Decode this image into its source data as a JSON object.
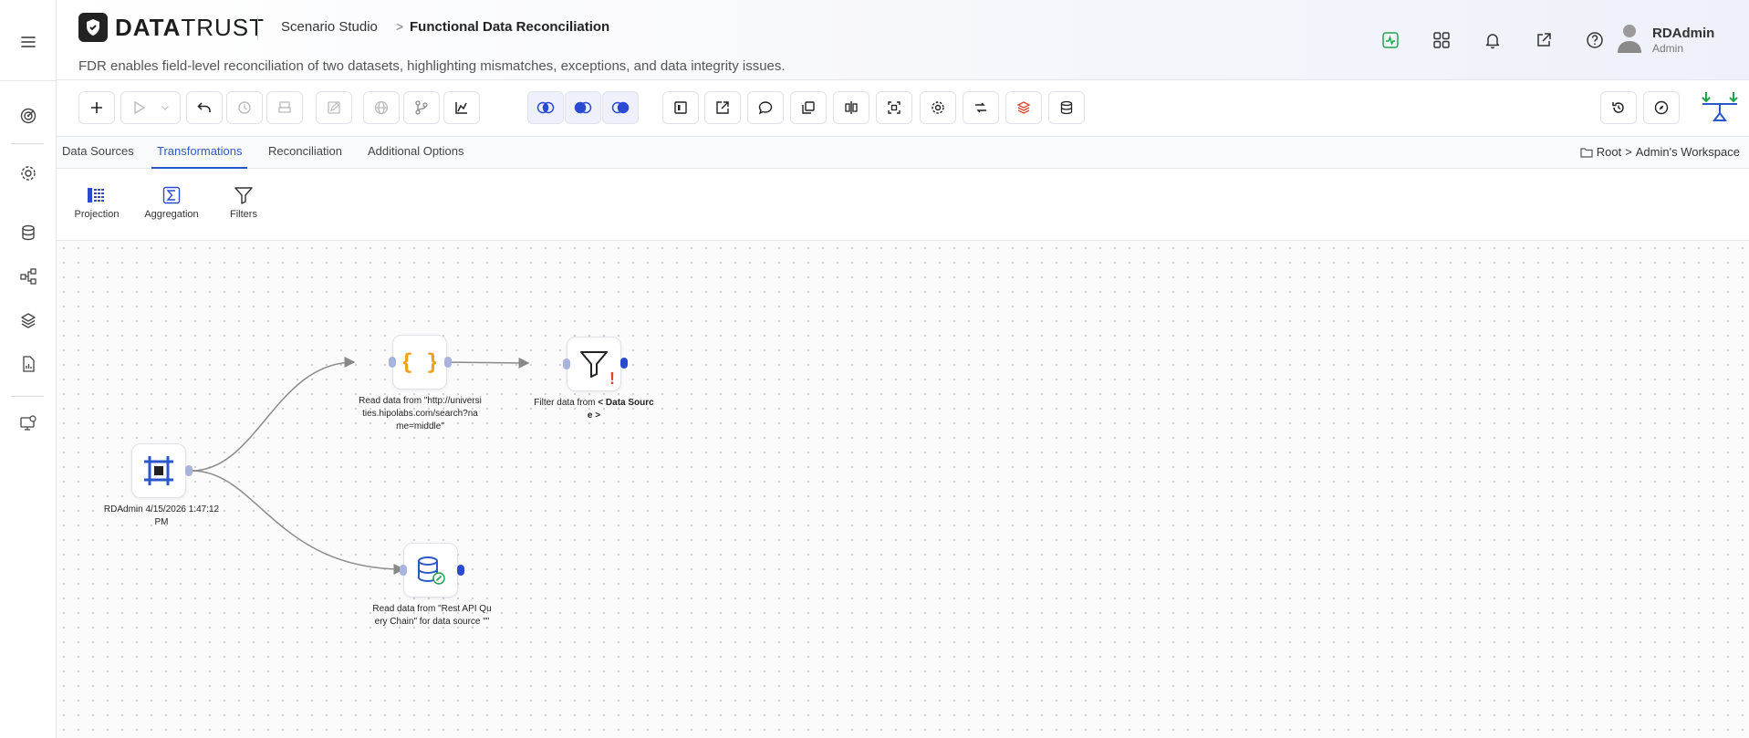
{
  "app": {
    "brand_bold": "DATA",
    "brand_light": "TRUST",
    "breadcrumb": {
      "parent": "Scenario Studio",
      "current": "Functional Data Reconciliation"
    },
    "subtitle": "FDR enables field-level reconciliation of two datasets, highlighting mismatches, exceptions, and data integrity issues."
  },
  "user": {
    "name": "RDAdmin",
    "role": "Admin"
  },
  "tabs": [
    {
      "label": "Data Sources",
      "active": false
    },
    {
      "label": "Transformations",
      "active": true
    },
    {
      "label": "Reconciliation",
      "active": false
    },
    {
      "label": "Additional Options",
      "active": false
    }
  ],
  "workspace": {
    "root": "Root",
    "sep": ">",
    "name": "Admin's Workspace"
  },
  "palette": [
    {
      "label": "Projection",
      "icon": "projection-icon"
    },
    {
      "label": "Aggregation",
      "icon": "sigma-icon"
    },
    {
      "label": "Filters",
      "icon": "filter-icon"
    }
  ],
  "nodes": {
    "source": {
      "label": "RDAdmin 4/15/2026 1:47:12 PM",
      "icon": "hash-grid-icon"
    },
    "json_read": {
      "label": "Read data from \"http://universities.hipolabs.com/search?name=middle\"",
      "icon": "json-braces-icon"
    },
    "filter": {
      "label_prefix": "Filter data from ",
      "label_bold": "< Data Source >",
      "icon": "filter-icon",
      "warning": "!"
    },
    "db_read": {
      "label": "Read data from \"Rest API Query Chain\" for data source \"\"",
      "icon": "database-link-icon"
    }
  },
  "colors": {
    "accent": "#2a58c9",
    "port": "#2a4bd1",
    "json": "#f0a21a",
    "warning": "#e0442e",
    "status_green": "#1fa34a"
  }
}
